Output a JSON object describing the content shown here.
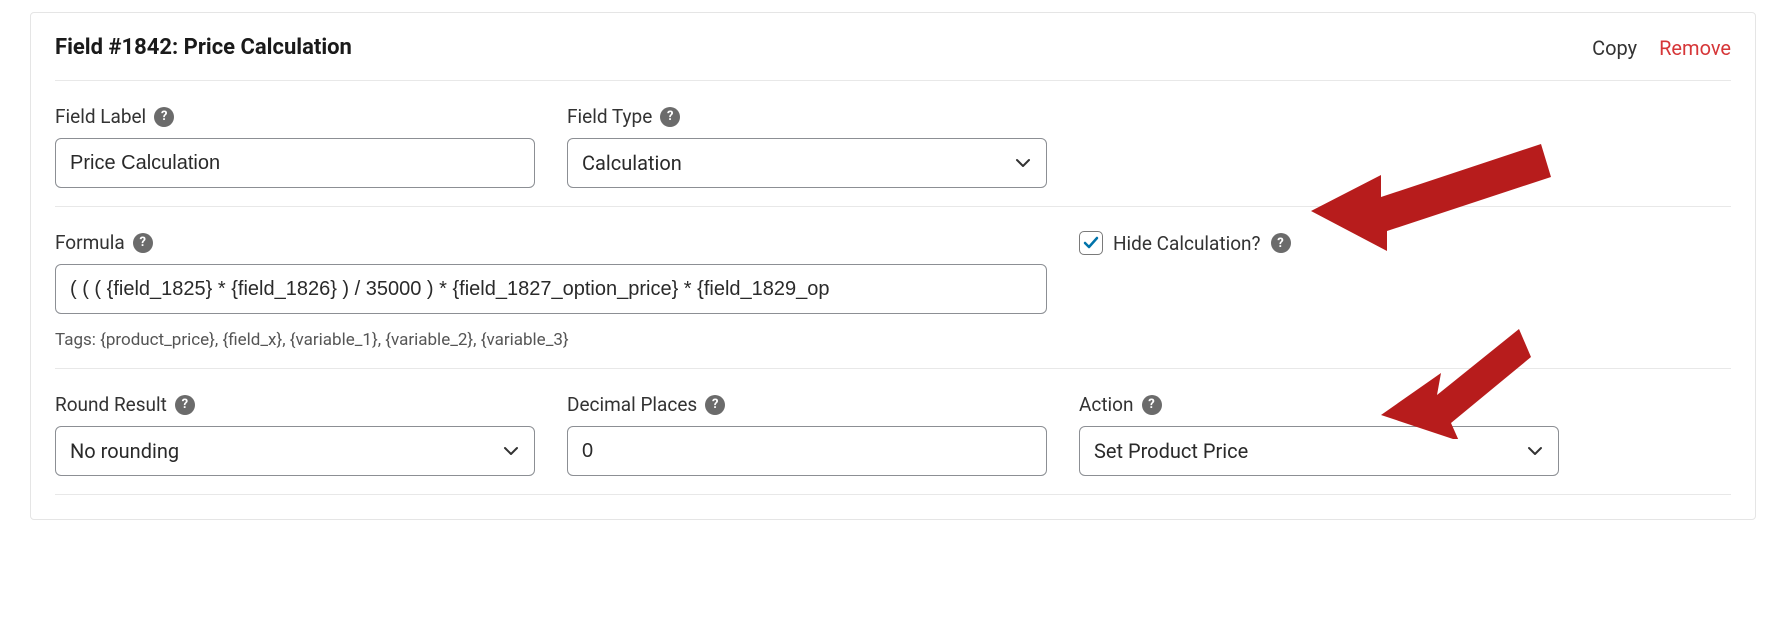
{
  "panel": {
    "title": "Field #1842: Price Calculation",
    "actions": {
      "copy": "Copy",
      "remove": "Remove"
    }
  },
  "fieldLabel": {
    "label": "Field Label",
    "value": "Price Calculation"
  },
  "fieldType": {
    "label": "Field Type",
    "value": "Calculation"
  },
  "formula": {
    "label": "Formula",
    "value": "( ( ( {field_1825} * {field_1826} ) / 35000 ) * {field_1827_option_price} * {field_1829_op",
    "hint": "Tags: {product_price}, {field_x}, {variable_1}, {variable_2}, {variable_3}"
  },
  "hideCalculation": {
    "label": "Hide Calculation?",
    "checked": true
  },
  "roundResult": {
    "label": "Round Result",
    "value": "No rounding"
  },
  "decimalPlaces": {
    "label": "Decimal Places",
    "value": "0"
  },
  "action": {
    "label": "Action",
    "value": "Set Product Price"
  },
  "colors": {
    "danger": "#d63638",
    "arrow": "#b71c1c"
  }
}
